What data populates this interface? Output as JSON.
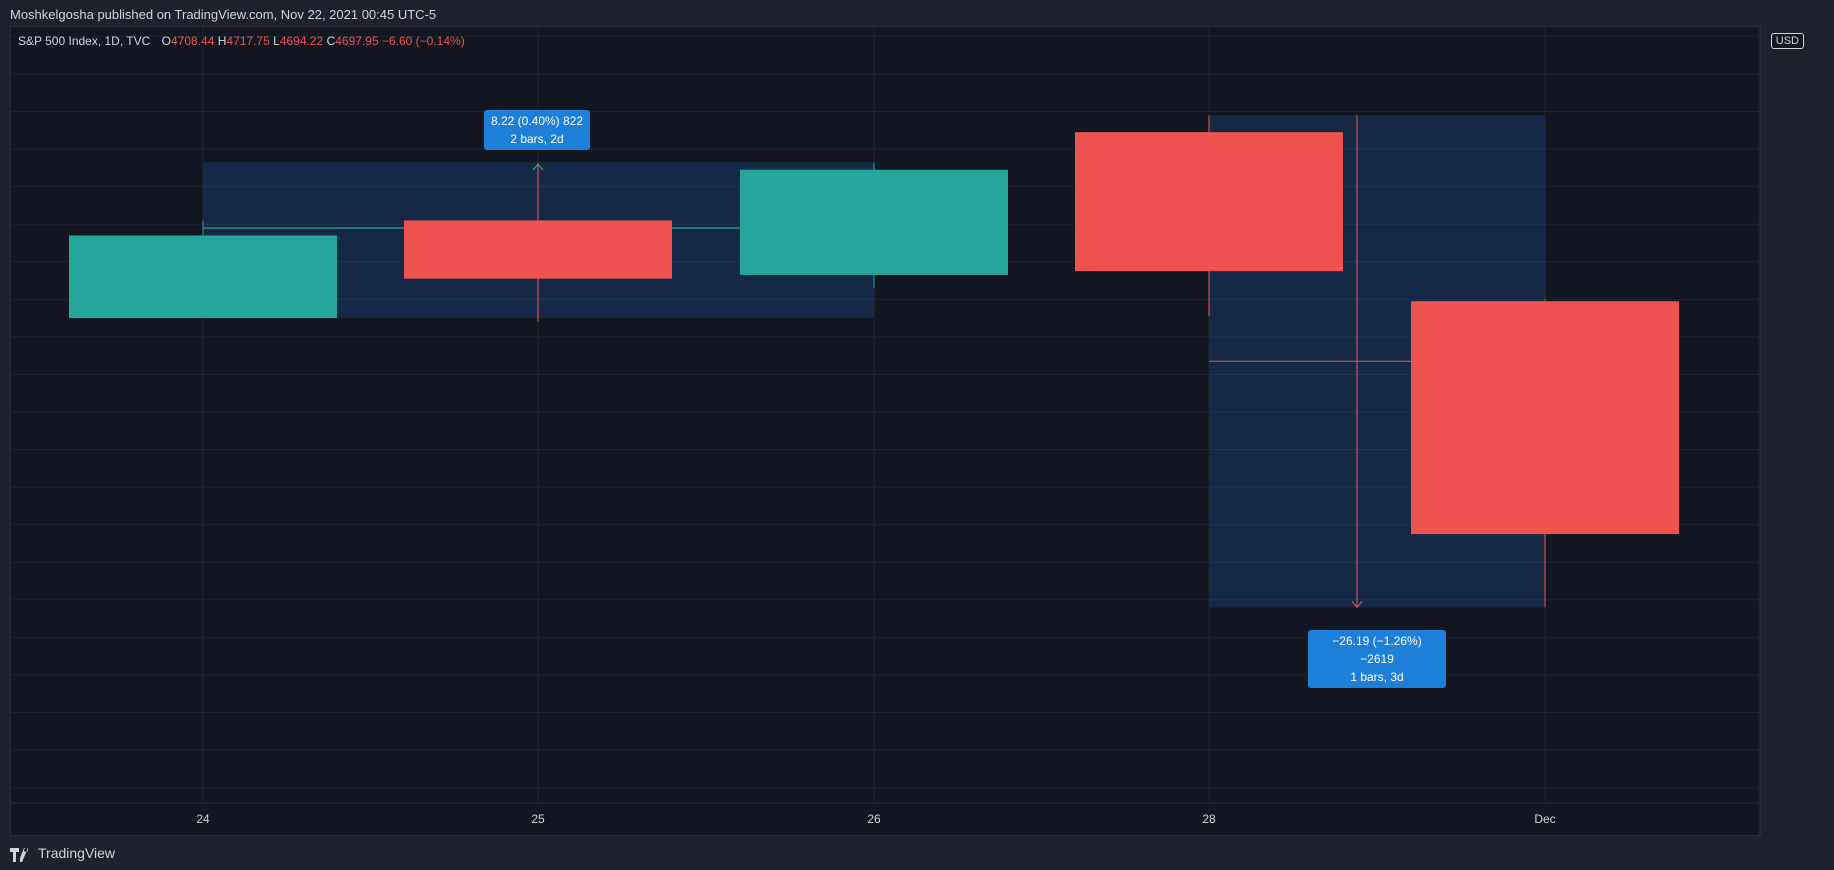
{
  "header": {
    "published_text": "Moshkelgosha published on TradingView.com, Nov 22, 2021 00:45 UTC-5"
  },
  "legend": {
    "symbol": "S&P 500 Index, 1D, TVC",
    "open_label": "O",
    "open": "4708.44",
    "high_label": "H",
    "high": "4717.75",
    "low_label": "L",
    "low": "4694.22",
    "close_label": "C",
    "close": "4697.95",
    "change": "−6.60 (−0.14%)"
  },
  "currency": "USD",
  "footer": {
    "brand": "TradingView"
  },
  "measurements": [
    {
      "line1": "8.22 (0.40%) 822",
      "line2": "2 bars, 2d"
    },
    {
      "line1": "−26.19 (−1.26%) −2619",
      "line2": "1 bars, 3d"
    }
  ],
  "chart_data": {
    "type": "candlestick",
    "ylim": [
      2039.5,
      2080.5
    ],
    "y_ticks": [
      "2040.00",
      "2042.00",
      "2044.00",
      "2046.00",
      "2048.00",
      "2050.00",
      "2052.00",
      "2054.00",
      "2056.00",
      "2058.00",
      "2060.00",
      "2062.00",
      "2064.00",
      "2066.00",
      "2068.00",
      "2070.00",
      "2072.00",
      "2074.00",
      "2076.00",
      "2078.00",
      "2080.00"
    ],
    "x_ticks": [
      "24",
      "25",
      "26",
      "28",
      "Dec"
    ],
    "colors": {
      "up": "#26a69a",
      "down": "#ef5350",
      "measure_up": "#1e7fd9",
      "grid": "#1f2433",
      "axis_text": "#d1d4dc"
    },
    "candles": [
      {
        "x": "24",
        "open": 2065.0,
        "high": 2070.2,
        "low": 2065.0,
        "close": 2069.4,
        "dir": "up"
      },
      {
        "x": "25",
        "open": 2070.2,
        "high": 2073.2,
        "low": 2064.8,
        "close": 2067.1,
        "dir": "down"
      },
      {
        "x": "26",
        "open": 2067.3,
        "high": 2073.3,
        "low": 2066.6,
        "close": 2072.9,
        "dir": "up"
      },
      {
        "x": "28",
        "open": 2074.9,
        "high": 2075.8,
        "low": 2065.1,
        "close": 2067.5,
        "dir": "down"
      },
      {
        "x": "Dec",
        "open": 2065.9,
        "high": 2066.0,
        "low": 2049.6,
        "close": 2053.5,
        "dir": "down"
      }
    ]
  }
}
